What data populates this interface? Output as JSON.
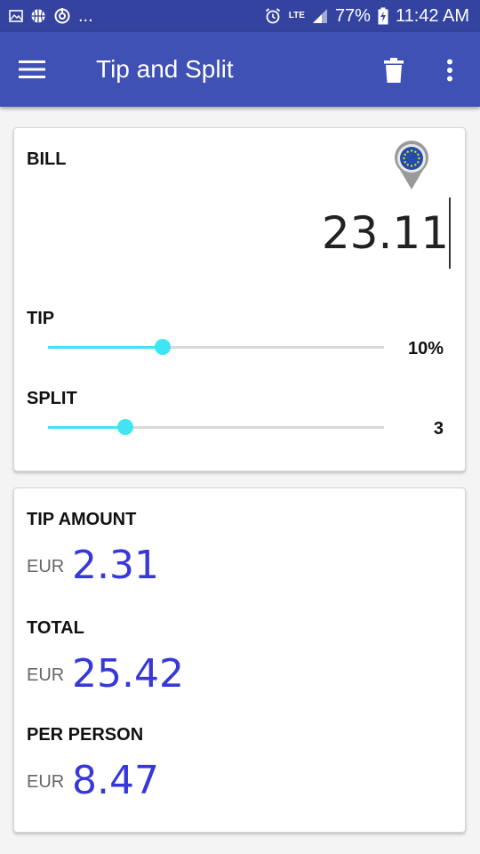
{
  "status_bar": {
    "dots": "...",
    "network": "LTE",
    "battery": "77%",
    "time": "11:42 AM"
  },
  "app_bar": {
    "title": "Tip and Split"
  },
  "bill": {
    "label": "BILL",
    "value": "23.11",
    "currency_flag": "eu-flag-pin-icon"
  },
  "tip": {
    "label": "TIP",
    "value": "10%",
    "slider_fraction": 0.34
  },
  "split": {
    "label": "SPLIT",
    "value": "3",
    "slider_fraction": 0.23
  },
  "results": {
    "tip_amount": {
      "label": "TIP AMOUNT",
      "currency": "EUR",
      "value": "2.31"
    },
    "total": {
      "label": "TOTAL",
      "currency": "EUR",
      "value": "25.42"
    },
    "per_person": {
      "label": "PER PERSON",
      "currency": "EUR",
      "value": "8.47"
    }
  },
  "colors": {
    "app_bar": "#3f51b5",
    "status_bar": "#3443a0",
    "accent": "#3de6f2",
    "amount": "#3838d9"
  }
}
